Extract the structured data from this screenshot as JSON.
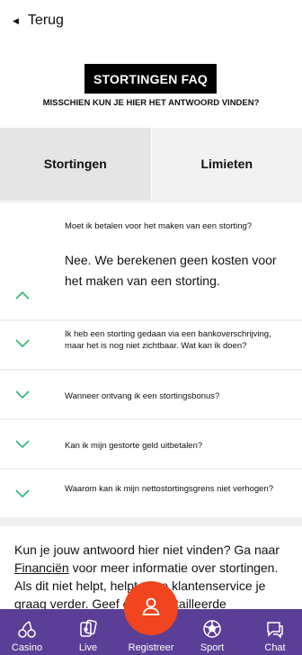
{
  "header": {
    "back_label": "Terug"
  },
  "hero": {
    "title": "STORTINGEN FAQ",
    "subtitle": "MISSCHIEN KUN JE HIER HET ANTWOORD VINDEN?"
  },
  "tabs": [
    {
      "label": "Stortingen",
      "active": true
    },
    {
      "label": "Limieten",
      "active": false
    }
  ],
  "faq": [
    {
      "question": "Moet ik betalen voor het maken van een storting?",
      "answer": "Nee. We berekenen geen kosten voor het maken van een storting.",
      "expanded": true
    },
    {
      "question": "Ik heb een storting gedaan via een bankoverschrijving, maar het is nog niet zichtbaar. Wat kan ik doen?",
      "expanded": false
    },
    {
      "question": "Wanneer ontvang ik een stortingsbonus?",
      "expanded": false
    },
    {
      "question": "Kan ik mijn gestorte geld uitbetalen?",
      "expanded": false
    },
    {
      "question": "Waarom kan ik mijn nettostortingsgrens niet verhogen?",
      "expanded": false
    }
  ],
  "footer_text": {
    "before_link": "Kun je jouw antwoord hier niet vinden? Ga naar ",
    "link": "Financiën",
    "after_link": " voor meer informatie over stortingen. Als dit niet helpt, helpt onze klantenservice je graag verder. Geef een gedetailleerde"
  },
  "bottom_nav": [
    {
      "label": "Casino",
      "icon": "cherries-icon"
    },
    {
      "label": "Live",
      "icon": "cards-icon"
    },
    {
      "label": "Registreer",
      "icon": "user-icon"
    },
    {
      "label": "Sport",
      "icon": "football-icon"
    },
    {
      "label": "Chat",
      "icon": "chat-icon"
    }
  ],
  "colors": {
    "nav_bg": "#5b3f96",
    "register_button": "#f0451e",
    "chevron": "#2bb673"
  }
}
